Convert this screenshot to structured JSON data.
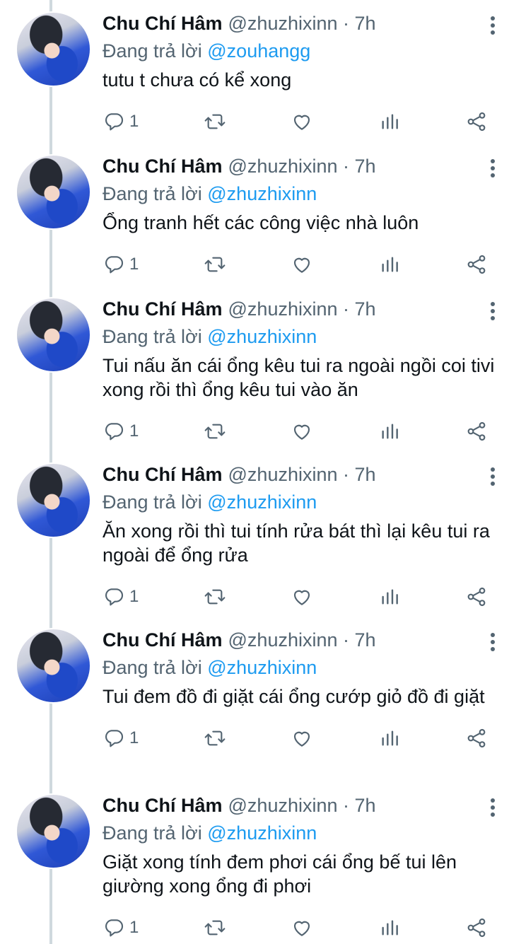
{
  "tweets": [
    {
      "name": "Chu Chí Hâm",
      "handle": "@zhuzhixinn · 7h",
      "reply_prefix": "Đang trả lời ",
      "reply_to": "@zouhangg",
      "text": "tutu t chưa có kể xong",
      "reply_count": "1"
    },
    {
      "name": "Chu Chí Hâm",
      "handle": "@zhuzhixinn · 7h",
      "reply_prefix": "Đang trả lời ",
      "reply_to": "@zhuzhixinn",
      "text": "Ổng tranh hết các công việc nhà luôn",
      "reply_count": "1"
    },
    {
      "name": "Chu Chí Hâm",
      "handle": "@zhuzhixinn · 7h",
      "reply_prefix": "Đang trả lời ",
      "reply_to": "@zhuzhixinn",
      "text": "Tui nấu ăn cái ổng kêu tui ra ngoài ngồi coi tivi xong rồi thì ổng kêu tui vào ăn",
      "reply_count": "1"
    },
    {
      "name": "Chu Chí Hâm",
      "handle": "@zhuzhixinn · 7h",
      "reply_prefix": "Đang trả lời ",
      "reply_to": "@zhuzhixinn",
      "text": "Ăn xong rồi thì tui tính rửa bát thì lại kêu tui ra ngoài để ổng rửa",
      "reply_count": "1"
    },
    {
      "name": "Chu Chí Hâm",
      "handle": "@zhuzhixinn · 7h",
      "reply_prefix": "Đang trả lời ",
      "reply_to": "@zhuzhixinn",
      "text": "Tui đem đồ đi giặt cái ổng cướp giỏ đồ đi giặt",
      "reply_count": "1"
    },
    {
      "name": "Chu Chí Hâm",
      "handle": "@zhuzhixinn · 7h",
      "reply_prefix": "Đang trả lời ",
      "reply_to": "@zhuzhixinn",
      "text": "Giặt xong tính đem phơi cái ổng bế tui lên giường xong ổng đi phơi",
      "reply_count": "1"
    }
  ],
  "colors": {
    "mention": "#1d9bf0",
    "secondary_text": "#536471",
    "thread_line": "#cfd9de"
  },
  "icons": [
    "reply-icon",
    "retweet-icon",
    "like-icon",
    "analytics-icon",
    "share-icon",
    "more-icon"
  ]
}
